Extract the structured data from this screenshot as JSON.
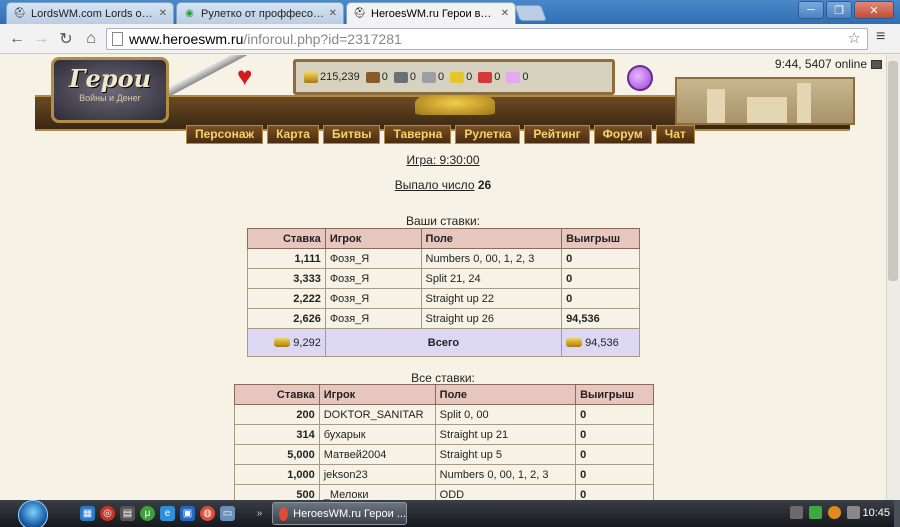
{
  "browser": {
    "tabs": [
      {
        "title": "LordsWM.com Lords of War a",
        "icon": "helmet-icon"
      },
      {
        "title": "Рулетко от проффесора - д",
        "icon": "green-circle-icon"
      },
      {
        "title": "HeroesWM.ru Герои войны",
        "icon": "helmet-icon",
        "active": true
      }
    ],
    "url_host": "www.heroeswm.ru",
    "url_path": "/inforoul.php?id=2317281",
    "window_buttons": [
      "─",
      "❐",
      "✕"
    ]
  },
  "game_header": {
    "logo_title": "Герои",
    "logo_subtitle": "Войны и Денег",
    "resources": [
      {
        "name": "gold",
        "value": "215,239"
      },
      {
        "name": "wood",
        "value": "0"
      },
      {
        "name": "ore",
        "value": "0"
      },
      {
        "name": "mercury",
        "value": "0"
      },
      {
        "name": "sulfur",
        "value": "0"
      },
      {
        "name": "crystals",
        "value": "0"
      },
      {
        "name": "gems",
        "value": "0"
      }
    ],
    "online_text": "9:44, 5407 online",
    "nav": [
      "Персонаж",
      "Карта",
      "Битвы",
      "Таверна",
      "Рулетка",
      "Рейтинг",
      "Форум",
      "Чат"
    ]
  },
  "game": {
    "game_time_link": "Игра: 9:30:00",
    "result_label": "Выпало число",
    "result_number": "26"
  },
  "your_bets": {
    "caption": "Ваши ставки:",
    "headers": [
      "Ставка",
      "Игрок",
      "Поле",
      "Выигрыш"
    ],
    "rows": [
      {
        "bet": "1,111",
        "player": "Фозя_Я",
        "field": "Numbers 0, 00, 1, 2, 3",
        "win": "0"
      },
      {
        "bet": "3,333",
        "player": "Фозя_Я",
        "field": "Split 21, 24",
        "win": "0"
      },
      {
        "bet": "2,222",
        "player": "Фозя_Я",
        "field": "Straight up 22",
        "win": "0"
      },
      {
        "bet": "2,626",
        "player": "Фозя_Я",
        "field": "Straight up 26",
        "win": "94,536"
      }
    ],
    "total_bet": "9,292",
    "total_label": "Всего",
    "total_win": "94,536"
  },
  "all_bets": {
    "caption": "Все ставки:",
    "headers": [
      "Ставка",
      "Игрок",
      "Поле",
      "Выигрыш"
    ],
    "rows": [
      {
        "bet": "200",
        "player": "DOKTOR_SANITAR",
        "field": "Split 0, 00",
        "win": "0"
      },
      {
        "bet": "314",
        "player": "бухарык",
        "field": "Straight up 21",
        "win": "0"
      },
      {
        "bet": "5,000",
        "player": "Матвей2004",
        "field": "Straight up 5",
        "win": "0"
      },
      {
        "bet": "1,000",
        "player": "jekson23",
        "field": "Numbers 0, 00, 1, 2, 3",
        "win": "0"
      },
      {
        "bet": "500",
        "player": "_Мелоки",
        "field": "ODD",
        "win": "0"
      }
    ]
  },
  "taskbar": {
    "task_title": "HeroesWM.ru Герои ...",
    "clock": "10:45"
  }
}
